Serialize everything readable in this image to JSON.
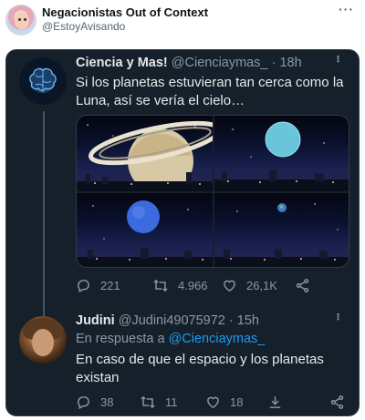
{
  "outer": {
    "name": "Negacionistas Out of Context",
    "handle": "@EstoyAvisando",
    "more_label": "···"
  },
  "tweet1": {
    "name": "Ciencia y Mas!",
    "handle": "@Cienciaymas_",
    "separator": " · ",
    "time": "18h",
    "text": "Si los planetas estuvieran tan cerca como la Luna, así se vería el cielo…",
    "images": [
      "saturn-sky",
      "uranus-sky",
      "neptune-sky",
      "earth-sky"
    ],
    "replies": "221",
    "retweets": "4.966",
    "likes": "26,1K",
    "more_label": "···"
  },
  "tweet2": {
    "name": "Judini",
    "handle": "@Judini49075972",
    "separator": " · ",
    "time": "15h",
    "reply_prefix": "En respuesta a ",
    "reply_to": "@Cienciaymas_",
    "text": "En caso de que el espacio y los planetas existan",
    "replies": "38",
    "retweets": "11",
    "likes": "18",
    "more_label": "···"
  },
  "colors": {
    "card_bg": "#15202b",
    "text_primary": "#e7e9ea",
    "text_secondary": "#8b98a5",
    "link": "#1d9bf0"
  }
}
